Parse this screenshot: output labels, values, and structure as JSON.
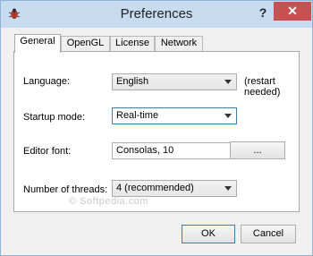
{
  "window": {
    "title": "Preferences",
    "help_glyph": "?",
    "close_glyph": "✕"
  },
  "tabs": [
    {
      "label": "General"
    },
    {
      "label": "OpenGL"
    },
    {
      "label": "License"
    },
    {
      "label": "Network"
    }
  ],
  "form": {
    "language_label": "Language:",
    "language_value": "English",
    "language_note": "(restart needed)",
    "startup_label": "Startup mode:",
    "startup_value": "Real-time",
    "editor_font_label": "Editor font:",
    "editor_font_value": "Consolas, 10",
    "browse_label": "...",
    "threads_label": "Number of threads:",
    "threads_value": "4 (recommended)"
  },
  "watermark": "© Softpedia.com",
  "footer": {
    "ok_label": "OK",
    "cancel_label": "Cancel"
  },
  "icons": {
    "app": "bug-icon"
  }
}
